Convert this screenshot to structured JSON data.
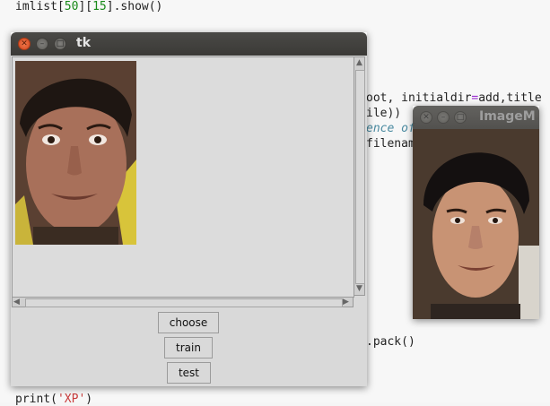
{
  "editor": {
    "line1": {
      "a": "imlist[",
      "n1": "50",
      "b": "][",
      "n2": "15",
      "c": "].show()"
    },
    "line2": {
      "a": "oot, initialdir",
      "eq": "=",
      "b": "add,title"
    },
    "line3": "ile))",
    "line4": "ence of",
    "line5": "filenam",
    "line6": ".pack()",
    "line7": {
      "a": "print(",
      "s": "'XP'",
      "b": ")"
    }
  },
  "tk_window": {
    "title": "tk",
    "buttons": {
      "choose": "choose",
      "train": "train",
      "test": "test"
    }
  },
  "image_window": {
    "title": "ImageM"
  },
  "colors": {
    "titlebar": "#3c3b37",
    "close": "#e05a2a",
    "client": "#d9d9d9"
  },
  "icons": [
    "close-icon",
    "minimize-icon",
    "maximize-icon"
  ]
}
